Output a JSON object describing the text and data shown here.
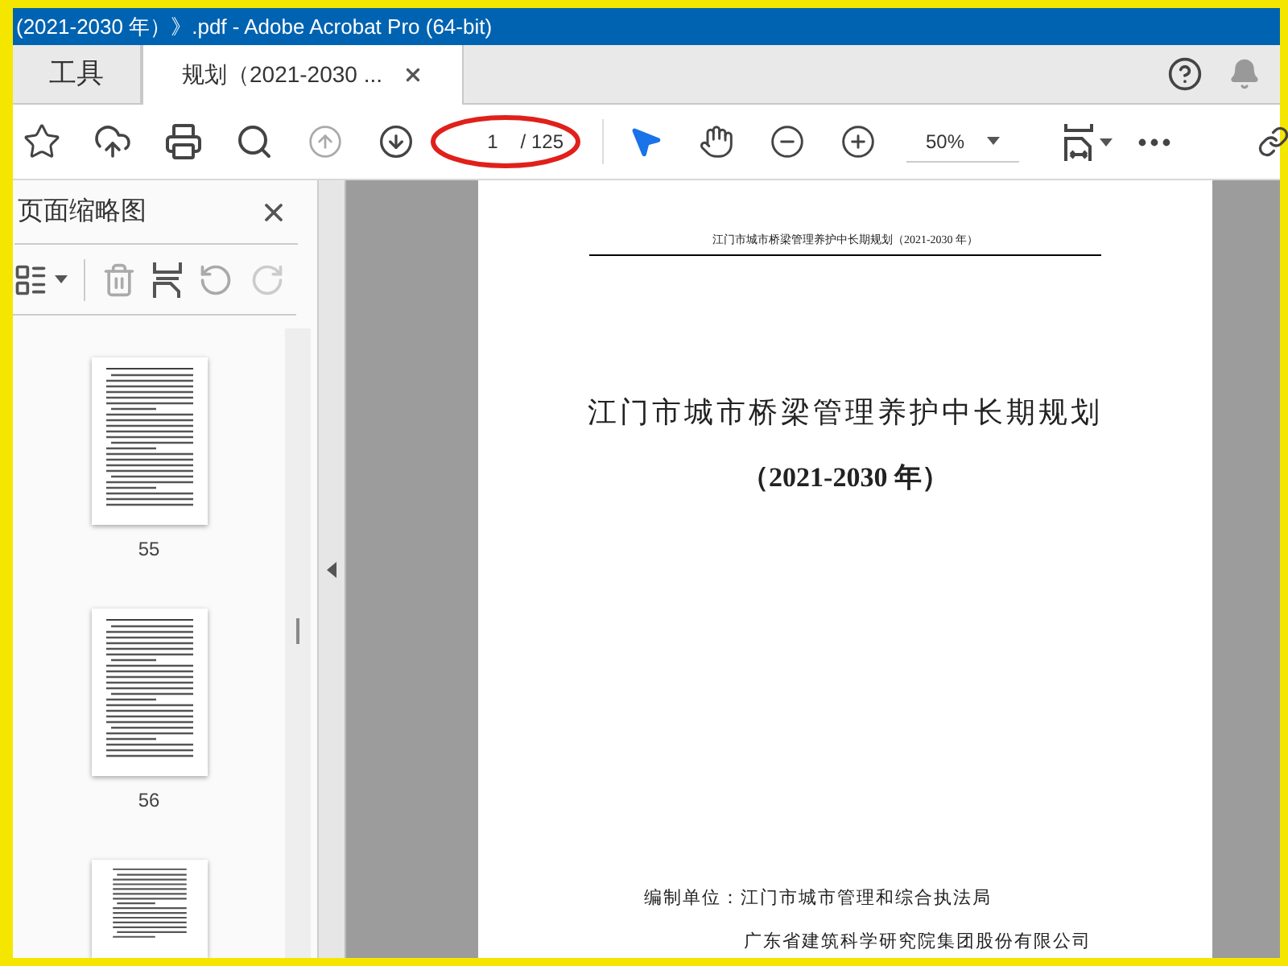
{
  "window": {
    "title": "(2021-2030 年）》.pdf - Adobe Acrobat Pro (64-bit)"
  },
  "tabs": [
    {
      "label": "工具",
      "selected": false,
      "closable": false
    },
    {
      "label": "规划（2021-2030 ...",
      "selected": true,
      "closable": true
    }
  ],
  "toolbar": {
    "page_value": "1",
    "page_total": "/ 125",
    "zoom": "50%"
  },
  "sidebar": {
    "title": "页面缩略图",
    "thumbnails": [
      {
        "label": "55"
      },
      {
        "label": "56"
      }
    ]
  },
  "document": {
    "running_header": "江门市城市桥梁管理养护中长期规划（2021-2030 年）",
    "title": "江门市城市桥梁管理养护中长期规划",
    "subtitle": "（2021-2030 年）",
    "prepared_by": "编制单位：江门市城市管理和综合执法局",
    "co_author": "广东省建筑科学研究院集团股份有限公司"
  }
}
